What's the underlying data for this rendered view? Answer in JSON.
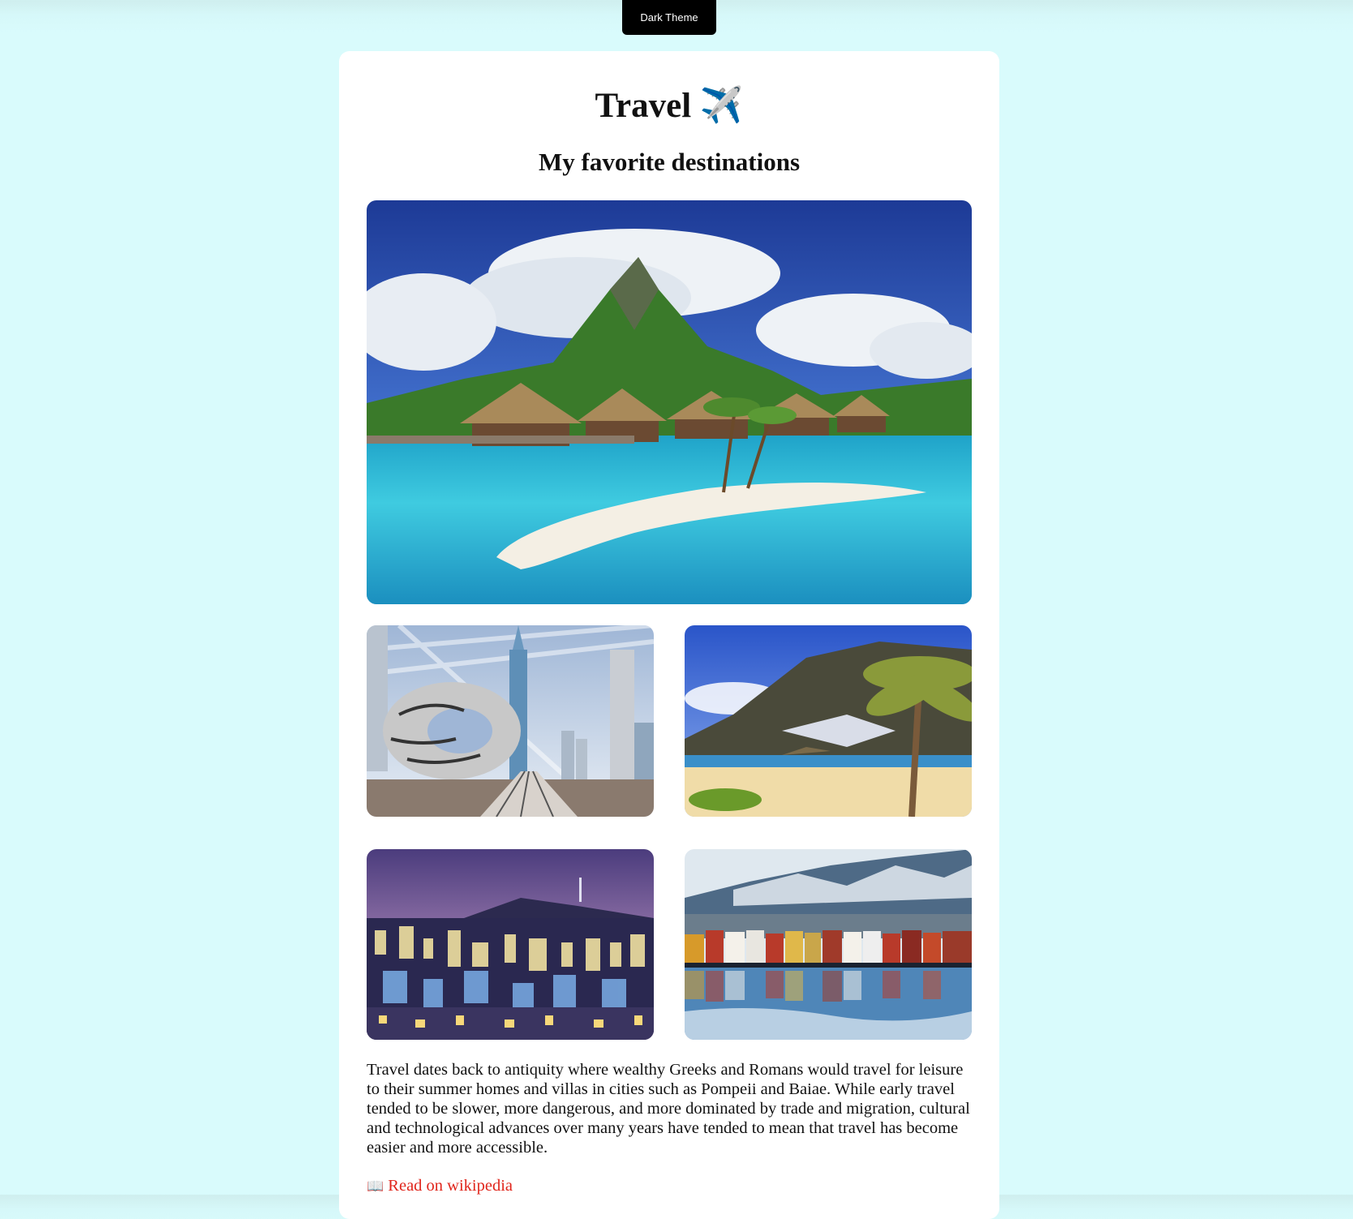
{
  "theme_toggle": {
    "label": "Dark Theme"
  },
  "header": {
    "title": "Travel",
    "title_icon": "✈️",
    "subtitle": "My favorite destinations"
  },
  "gallery": {
    "main_image": "tropical-island-overwater-bungalows",
    "images": [
      "dubai-museum-of-future-skyline",
      "palm-beach-village",
      "seoul-night-skyline",
      "bergen-colorful-houses-winter"
    ]
  },
  "content": {
    "description": "Travel dates back to antiquity where wealthy Greeks and Romans would travel for leisure to their summer homes and villas in cities such as Pompeii and Baiae. While early travel tended to be slower, more dangerous, and more dominated by trade and migration, cultural and technological advances over many years have tended to mean that travel has become easier and more accessible.",
    "link_icon": "📖",
    "link_label": "Read on wikipedia"
  },
  "colors": {
    "background": "#d9fbfc",
    "card": "#ffffff",
    "button": "#000000",
    "link": "#e0251b"
  }
}
